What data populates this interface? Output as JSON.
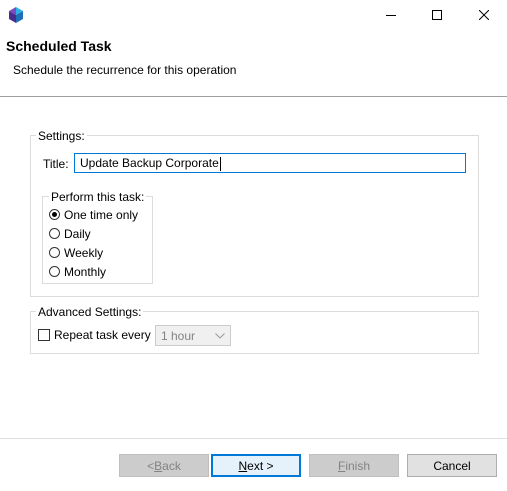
{
  "window": {
    "minimize_icon": "minimize-icon",
    "maximize_icon": "maximize-icon",
    "close_icon": "close-icon"
  },
  "header": {
    "title": "Scheduled Task",
    "subtitle": "Schedule the recurrence for this operation"
  },
  "settings": {
    "legend": "Settings:",
    "title_label": "Title:",
    "title_value": "Update Backup Corporate",
    "perform": {
      "legend": "Perform this task:",
      "options": [
        {
          "label": "One time only",
          "checked": true
        },
        {
          "label": "Daily",
          "checked": false
        },
        {
          "label": "Weekly",
          "checked": false
        },
        {
          "label": "Monthly",
          "checked": false
        }
      ]
    }
  },
  "advanced": {
    "legend": "Advanced Settings:",
    "repeat_label": "Repeat task every",
    "repeat_checked": false,
    "interval_value": "1 hour"
  },
  "footer": {
    "back_pre": "< ",
    "back_mnemonic": "B",
    "back_post": "ack",
    "next_mnemonic": "N",
    "next_post": "ext >",
    "finish_mnemonic": "F",
    "finish_post": "inish",
    "cancel": "Cancel"
  },
  "colors": {
    "accent": "#0078d7",
    "disabled_text": "#838383"
  }
}
